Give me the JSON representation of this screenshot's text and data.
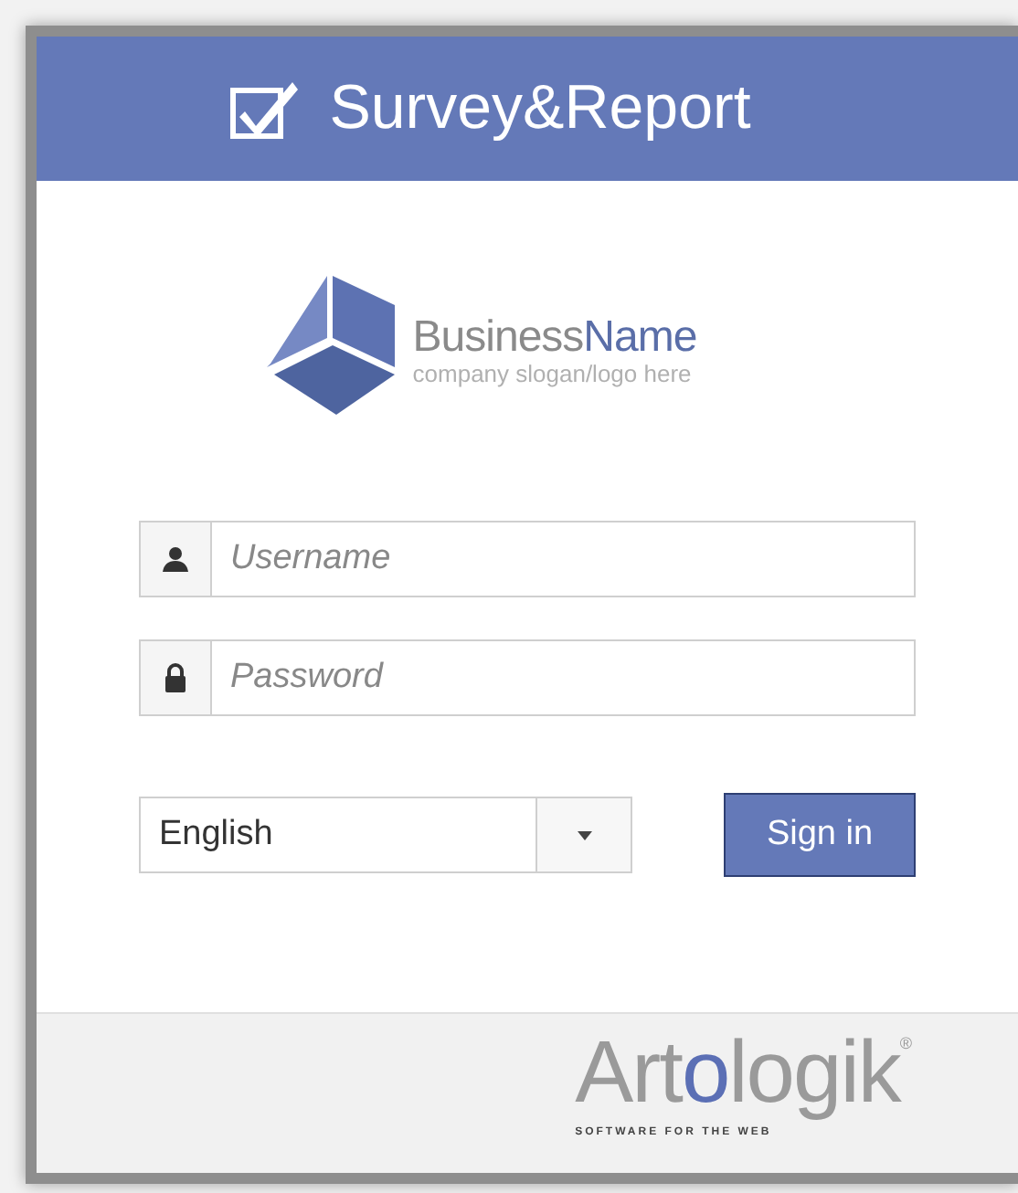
{
  "header": {
    "title": "Survey&Report"
  },
  "company_logo": {
    "name_parts": [
      "Business",
      "Name"
    ],
    "slogan": "company slogan/logo here"
  },
  "form": {
    "username": {
      "placeholder": "Username"
    },
    "password": {
      "placeholder": "Password"
    },
    "language": {
      "value": "English"
    },
    "submit": "Sign in"
  },
  "footer": {
    "brand_parts": [
      "Art",
      "o",
      "logik"
    ],
    "registered": "®",
    "tagline": "SOFTWARE FOR THE WEB"
  }
}
